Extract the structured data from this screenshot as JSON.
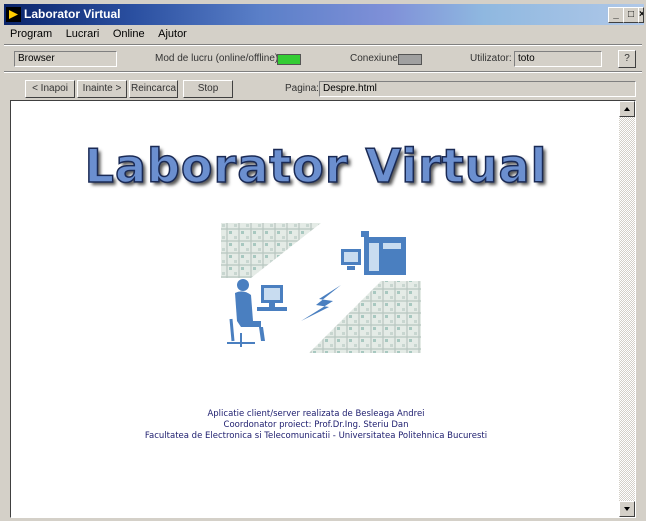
{
  "window": {
    "title": "Laborator Virtual",
    "controls": {
      "minimize": "_",
      "maximize": "□",
      "close": "×"
    }
  },
  "menu": [
    "Program",
    "Lucrari",
    "Online",
    "Ajutor"
  ],
  "toolbar": {
    "mode_field": "Browser",
    "mode_label": "Mod de lucru (online/offline):",
    "mode_led_color": "#33cc33",
    "connection_label": "Conexiune:",
    "connection_led_color": "#a0a0a0",
    "user_label": "Utilizator:",
    "user_value": "toto",
    "help_label": "?"
  },
  "nav": {
    "back": "< Inapoi",
    "forward": "Inainte >",
    "reload": "Reincarca",
    "stop": "Stop",
    "page_label": "Pagina:",
    "page_value": "Despre.html"
  },
  "page": {
    "heading": "Laborator Virtual",
    "credits": [
      "Aplicatie client/server realizata de Besleaga Andrei",
      "Coordonator proiect: Prof.Dr.Ing. Steriu Dan",
      "Facultatea de Electronica si Telecomunicatii - Universitatea Politehnica Bucuresti"
    ]
  },
  "colors": {
    "illustration_blue": "#4a7fc0",
    "credits_text": "#202070"
  }
}
